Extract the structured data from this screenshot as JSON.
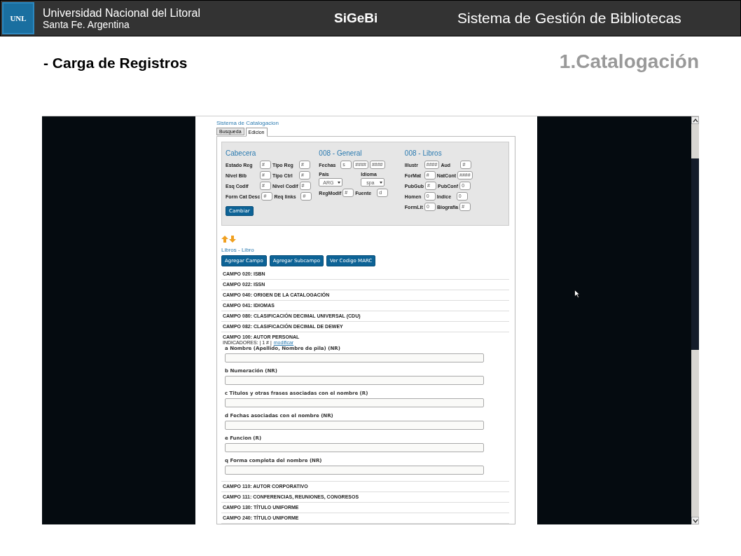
{
  "header": {
    "logo": "UNL",
    "university": "Universidad Nacional del Litoral",
    "city": "Santa Fe. Argentina",
    "app": "SiGeBi",
    "system": "Sistema de Gestión de Bibliotecas"
  },
  "slide": {
    "subtitle": "- Carga de Registros",
    "section": "1.Catalogación"
  },
  "app": {
    "title": "Sistema de Catalogacion",
    "tabs": [
      {
        "label": "Busqueda",
        "selected": false
      },
      {
        "label": "Edicion",
        "selected": true
      }
    ],
    "columns": [
      {
        "title": "Cabecera",
        "rows": [
          [
            {
              "kind": "input",
              "label": "Estado Reg",
              "values": [
                "#"
              ]
            },
            {
              "kind": "input",
              "label": "Tipo Reg",
              "values": [
                "#"
              ]
            }
          ],
          [
            {
              "kind": "input",
              "label": "Nivel Bib",
              "values": [
                "#"
              ]
            },
            {
              "kind": "input",
              "label": "Tipo Ctrl",
              "values": [
                "#"
              ]
            }
          ],
          [
            {
              "kind": "input",
              "label": "Esq Codif",
              "values": [
                "#"
              ]
            },
            {
              "kind": "input",
              "label": "Nivel Codif",
              "values": [
                "#"
              ]
            }
          ],
          [
            {
              "kind": "input",
              "label": "Form Cat Desc",
              "values": [
                "#"
              ]
            },
            {
              "kind": "input",
              "label": "Req links",
              "values": [
                "#"
              ]
            }
          ]
        ],
        "button": "Cambiar"
      },
      {
        "title": "008 - General",
        "rows": [
          [
            {
              "kind": "input",
              "label": "Fechas",
              "values": [
                "s",
                "####",
                "####"
              ]
            }
          ],
          [
            {
              "kind": "select",
              "label": "Pais",
              "values": [
                "ARG"
              ]
            },
            {
              "kind": "select",
              "label": "Idioma",
              "values": [
                "spa"
              ]
            }
          ],
          [
            {
              "kind": "input",
              "label": "RegModif",
              "values": [
                "#"
              ]
            },
            {
              "kind": "input",
              "label": "Fuente",
              "values": [
                "d"
              ]
            }
          ]
        ]
      },
      {
        "title": "008 - Libros",
        "rows": [
          [
            {
              "kind": "input",
              "label": "Illustr",
              "values": [
                "####"
              ]
            },
            {
              "kind": "input",
              "label": "Aud",
              "values": [
                "#"
              ]
            }
          ],
          [
            {
              "kind": "input",
              "label": "ForMat",
              "values": [
                "#"
              ]
            },
            {
              "kind": "input",
              "label": "NatCont",
              "values": [
                "####"
              ]
            }
          ],
          [
            {
              "kind": "input",
              "label": "PubGub",
              "values": [
                "#"
              ]
            },
            {
              "kind": "input",
              "label": "PubConf",
              "values": [
                "0"
              ]
            }
          ],
          [
            {
              "kind": "input",
              "label": "Homen",
              "values": [
                "0"
              ]
            },
            {
              "kind": "input",
              "label": "Indice",
              "values": [
                "0"
              ]
            }
          ],
          [
            {
              "kind": "input",
              "label": "FormLit",
              "values": [
                "0"
              ]
            },
            {
              "kind": "input",
              "label": "Biografia",
              "values": [
                "#"
              ]
            }
          ]
        ]
      }
    ],
    "template": "Libros - Libro",
    "buttons": [
      "Agregar Campo",
      "Agregar Subcampo",
      "Ver Codigo MARC"
    ],
    "campos": [
      {
        "label": "CAMPO 020: ISBN"
      },
      {
        "label": "CAMPO 022: ISSN"
      },
      {
        "label": "CAMPO 040: ORIGEN DE LA CATALOGACIÓN"
      },
      {
        "label": "CAMPO 041: IDIOMAS"
      },
      {
        "label": "CAMPO 080: CLASIFICACIÓN DECIMAL UNIVERSAL (CDU)"
      },
      {
        "label": "CAMPO 082: CLASIFICACIÓN DECIMAL DE DEWEY"
      },
      {
        "label": "CAMPO 100: AUTOR PERSONAL",
        "indicators": "INDICADORES: | 1 # |",
        "indicators_link": "modificar",
        "subfields": [
          "a Nombre (Apellido, Nombre de pila) (NR)",
          "b Numeración (NR)",
          "c Titulos y otras frases asociadas con el nombre (R)",
          "d Fechas asociadas con el nombre (NR)",
          "e Funcion (R)",
          "q Forma completa del nombre (NR)"
        ]
      },
      {
        "label": "CAMPO 110: AUTOR CORPORATIVO"
      },
      {
        "label": "CAMPO 111: CONFERENCIAS, REUNIONES, CONGRESOS"
      },
      {
        "label": "CAMPO 130: TÍTULO UNIFORME"
      },
      {
        "label": "CAMPO 240: TÍTULO UNIFORME"
      }
    ]
  }
}
